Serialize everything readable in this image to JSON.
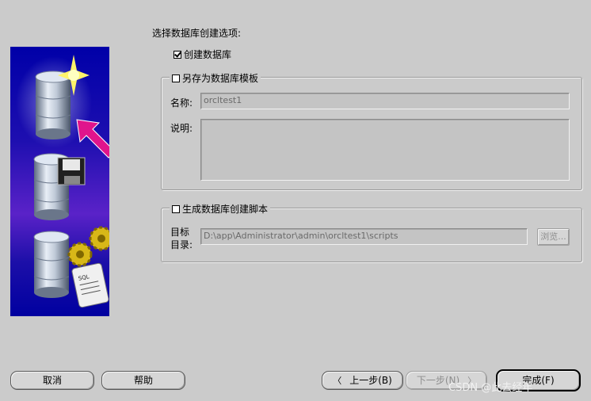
{
  "heading": "选择数据库创建选项:",
  "create_db": {
    "label": "创建数据库",
    "checked": true
  },
  "save_template": {
    "label": "另存为数据库模板",
    "checked": false,
    "name_label": "名称:",
    "name_value": "orcltest1",
    "desc_label": "说明:",
    "desc_value": ""
  },
  "gen_scripts": {
    "label": "生成数据库创建脚本",
    "checked": false,
    "dir_label_1": "目标",
    "dir_label_2": "目录:",
    "dir_value": "D:\\app\\Administrator\\admin\\orcltest1\\scripts",
    "browse_label": "浏览..."
  },
  "buttons": {
    "cancel": "取消",
    "help": "帮助",
    "back": "上一步(B)",
    "next": "下一步(N)",
    "finish": "完成(F)"
  },
  "watermark": "CSDN @此去经年",
  "illustration": {
    "sql_text": "SQL"
  },
  "colors": {
    "window_bg": "#cbcbcb",
    "illustration_bg": "#0000a8",
    "arrow": "#e0148c"
  }
}
